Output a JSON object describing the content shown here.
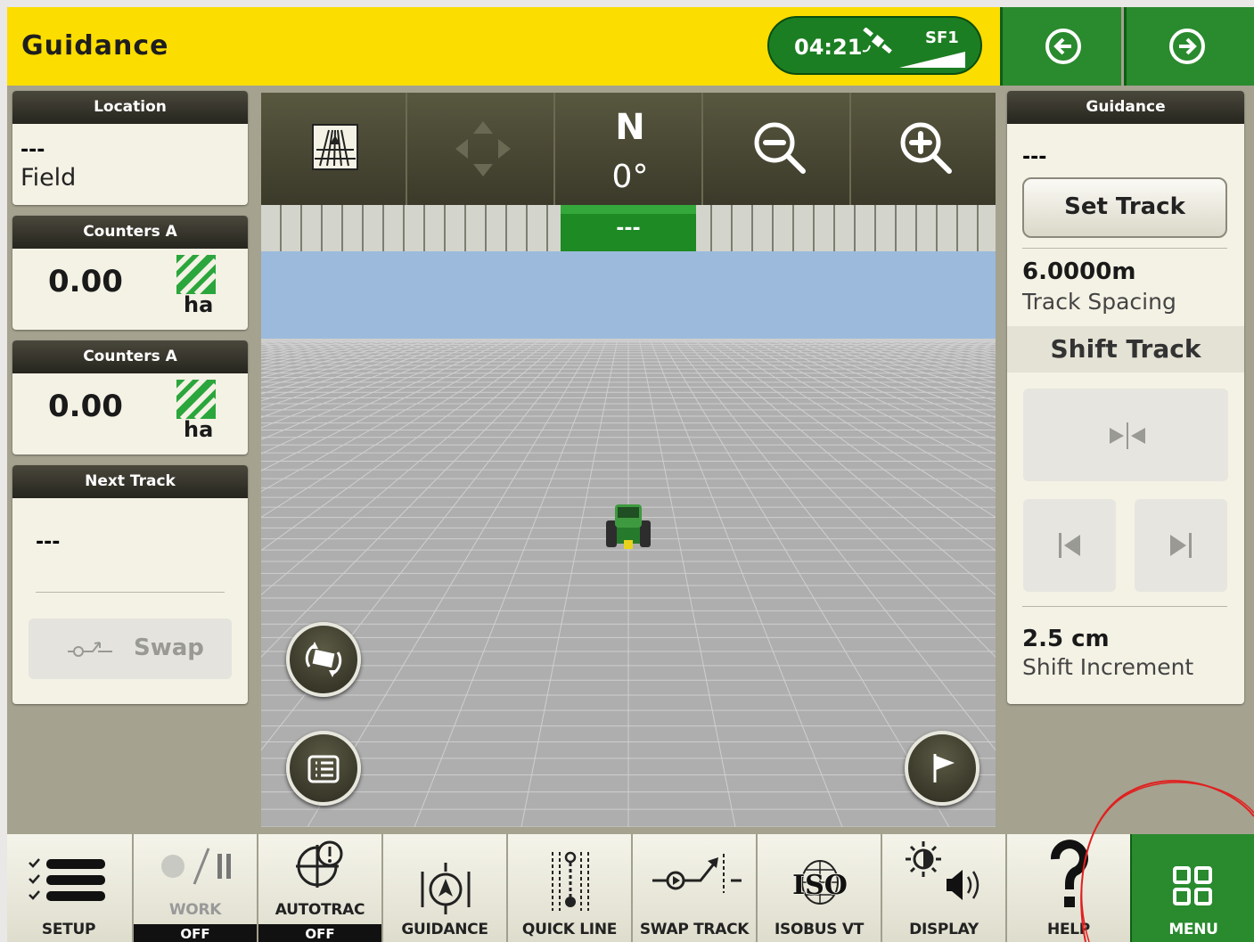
{
  "header": {
    "title": "Guidance",
    "clock": "04:21",
    "signal_label": "SF1"
  },
  "nav": {
    "back": "back",
    "forward": "forward"
  },
  "location": {
    "heading": "Location",
    "name": "---",
    "field": "Field"
  },
  "counter1": {
    "heading": "Counters A",
    "value": "0.00",
    "unit": "ha"
  },
  "counter2": {
    "heading": "Counters A",
    "value": "0.00",
    "unit": "ha"
  },
  "next_track": {
    "heading": "Next Track",
    "value": "---",
    "swap_label": "Swap"
  },
  "map": {
    "compass_dir": "N",
    "compass_deg": "0°",
    "lightbar_value": "---"
  },
  "right": {
    "heading": "Guidance",
    "track_name": "---",
    "set_track_label": "Set Track",
    "track_spacing_value": "6.0000m",
    "track_spacing_label": "Track Spacing",
    "shift_track_label": "Shift Track",
    "shift_increment_value": "2.5 cm",
    "shift_increment_label": "Shift Increment"
  },
  "tabs": [
    {
      "label": "SETUP"
    },
    {
      "label": "WORK",
      "state": "OFF"
    },
    {
      "label": "AUTOTRAC",
      "state": "OFF"
    },
    {
      "label": "GUIDANCE"
    },
    {
      "label": "QUICK LINE"
    },
    {
      "label": "SWAP TRACK"
    },
    {
      "label": "ISOBUS VT"
    },
    {
      "label": "DISPLAY"
    },
    {
      "label": "HELP"
    },
    {
      "label": "MENU"
    }
  ],
  "colors": {
    "header_yellow": "#fcdd00",
    "jd_green": "#2a8a2e",
    "annotation_red": "#e02020"
  },
  "icons": [
    "satellite-icon",
    "back-arrow-icon",
    "forward-arrow-icon",
    "area-icon",
    "field-view-icon",
    "pan-icon",
    "zoom-out-icon",
    "zoom-in-icon",
    "rotate-view-icon",
    "list-icon",
    "flag-icon",
    "tractor-icon",
    "center-shift-icon",
    "shift-left-icon",
    "shift-right-icon",
    "setup-icon",
    "work-icon",
    "autotrac-icon",
    "guidance-icon",
    "quick-line-icon",
    "swap-track-icon",
    "iso-icon",
    "display-icon",
    "help-icon",
    "menu-icon"
  ]
}
